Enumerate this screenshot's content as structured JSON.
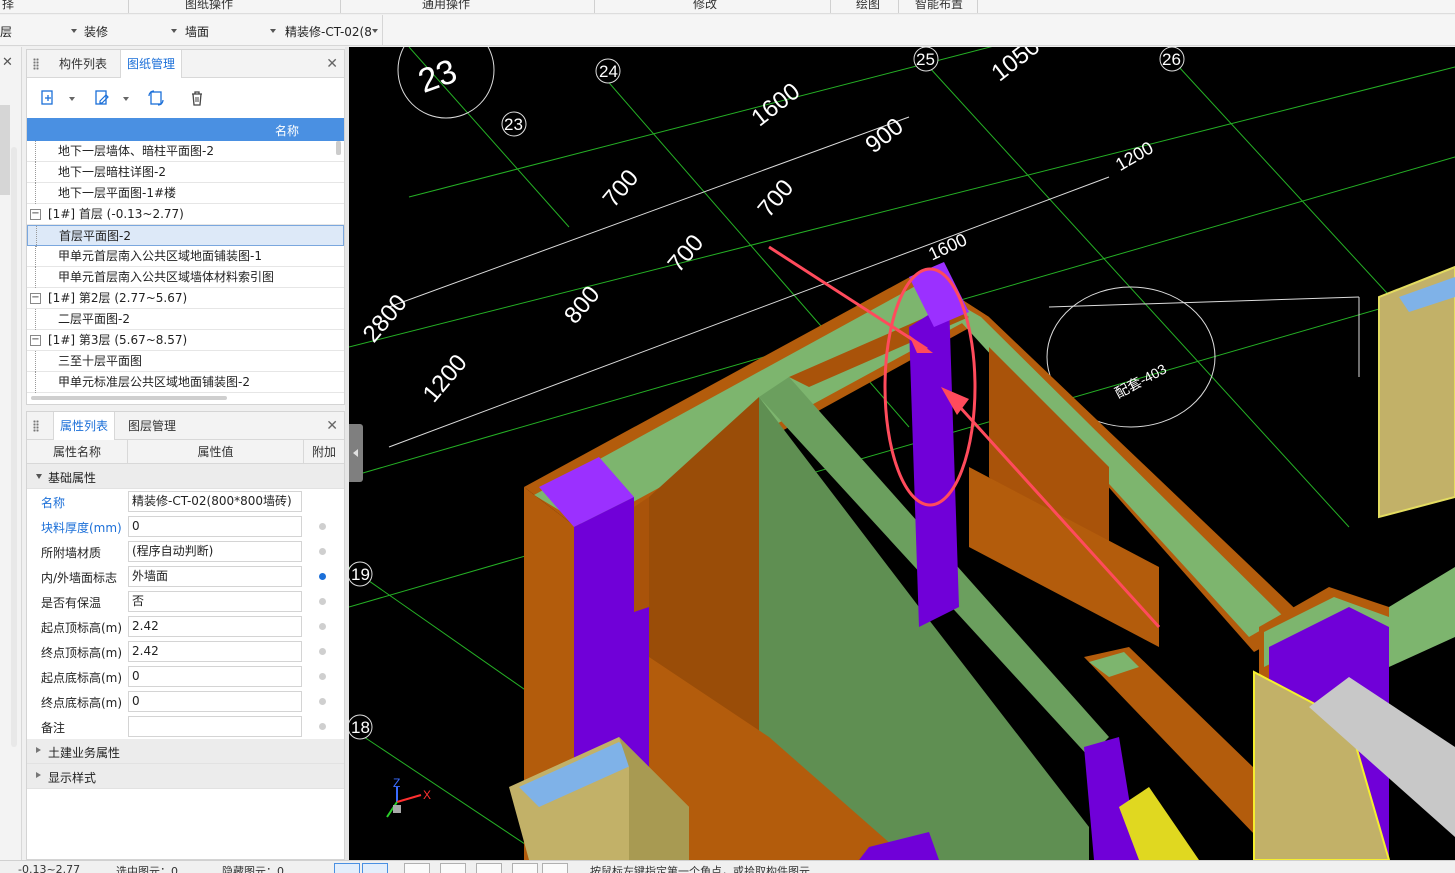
{
  "ribbon": {
    "groups": [
      "择",
      "图纸操作",
      "通用操作",
      "修改",
      "绘图",
      "智能布置"
    ]
  },
  "selectors": {
    "floor": "层",
    "type": "装修",
    "subtype": "墙面",
    "component": "精装修-CT-02(8"
  },
  "drawing_panel": {
    "tabs": [
      "构件列表",
      "图纸管理"
    ],
    "active_tab": "图纸管理",
    "column_header": "名称",
    "rows": [
      {
        "label": "地下一层墙体、暗柱平面图-2",
        "group": false
      },
      {
        "label": "地下一层暗柱详图-2",
        "group": false
      },
      {
        "label": "地下一层平面图-1#楼",
        "group": false
      },
      {
        "label": "[1#] 首层 (-0.13~2.77)",
        "group": true
      },
      {
        "label": "首层平面图-2",
        "group": false,
        "selected": true
      },
      {
        "label": "甲单元首层南入公共区域地面铺装图-1",
        "group": false
      },
      {
        "label": "甲单元首层南入公共区域墙体材料索引图",
        "group": false
      },
      {
        "label": "[1#] 第2层 (2.77~5.67)",
        "group": true
      },
      {
        "label": "二层平面图-2",
        "group": false
      },
      {
        "label": "[1#] 第3层 (5.67~8.57)",
        "group": true
      },
      {
        "label": "三至十层平面图",
        "group": false
      },
      {
        "label": "甲单元标准层公共区域地面铺装图-2",
        "group": false
      }
    ]
  },
  "property_panel": {
    "tabs": [
      "属性列表",
      "图层管理"
    ],
    "active_tab": "属性列表",
    "columns": [
      "属性名称",
      "属性值",
      "附加"
    ],
    "section_basic": "基础属性",
    "rows": [
      {
        "name": "名称",
        "value": "精装修-CT-02(800*800墙砖)",
        "blue": true,
        "dot": "none"
      },
      {
        "name": "块料厚度(mm)",
        "value": "0",
        "blue": true,
        "dot": "off"
      },
      {
        "name": "所附墙材质",
        "value": "(程序自动判断)",
        "blue": false,
        "dot": "off"
      },
      {
        "name": "内/外墙面标志",
        "value": "外墙面",
        "blue": false,
        "dot": "on"
      },
      {
        "name": "是否有保温",
        "value": "否",
        "blue": false,
        "dot": "off"
      },
      {
        "name": "起点顶标高(m)",
        "value": "2.42",
        "blue": false,
        "dot": "off"
      },
      {
        "name": "终点顶标高(m)",
        "value": "2.42",
        "blue": false,
        "dot": "off"
      },
      {
        "name": "起点底标高(m)",
        "value": "0",
        "blue": false,
        "dot": "off"
      },
      {
        "name": "终点底标高(m)",
        "value": "0",
        "blue": false,
        "dot": "off"
      },
      {
        "name": "备注",
        "value": "",
        "blue": false,
        "dot": "off"
      }
    ],
    "section_civil": "土建业务属性",
    "section_display": "显示样式"
  },
  "viewport": {
    "axis_labels": [
      "23",
      "24",
      "25",
      "26",
      "23",
      "19",
      "18"
    ],
    "dims": [
      "1600",
      "1050",
      "900",
      "1200",
      "700",
      "700",
      "700",
      "2800",
      "800",
      "1200",
      "1600"
    ],
    "room_tag": "配套-403",
    "axis_x": "X",
    "axis_z": "Z"
  },
  "colors": {
    "accent": "#4a90e2",
    "wall_orange": "#b75a0a",
    "slab_green": "#78a86c",
    "column_purple": "#7000d8",
    "annotation_red": "#ff4b5c"
  },
  "statusbar": {
    "elevation": "-0.13~2.77",
    "selected": "选中图元：0",
    "hidden": "隐藏图元：0",
    "hint": "按鼠标左键指定第一个角点，或拾取构件图元"
  }
}
